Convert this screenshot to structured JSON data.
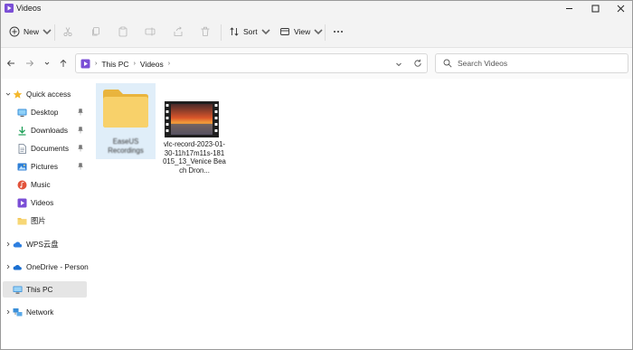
{
  "window": {
    "title": "Videos"
  },
  "toolbar": {
    "new_label": "New",
    "sort_label": "Sort",
    "view_label": "View"
  },
  "breadcrumbs": [
    "This PC",
    "Videos"
  ],
  "search": {
    "placeholder": "Search Videos"
  },
  "sidebar": {
    "items": [
      {
        "label": "Quick access",
        "icon": "star-icon"
      },
      {
        "label": "Desktop",
        "icon": "desktop-icon",
        "pinned": true
      },
      {
        "label": "Downloads",
        "icon": "download-icon",
        "pinned": true
      },
      {
        "label": "Documents",
        "icon": "document-icon",
        "pinned": true
      },
      {
        "label": "Pictures",
        "icon": "pictures-icon",
        "pinned": true
      },
      {
        "label": "Music",
        "icon": "music-icon"
      },
      {
        "label": "Videos",
        "icon": "videos-icon"
      },
      {
        "label": "图片",
        "icon": "folder-icon"
      },
      {
        "label": "WPS云盘",
        "icon": "cloud-icon"
      },
      {
        "label": "OneDrive - Personal",
        "icon": "onedrive-icon"
      },
      {
        "label": "This PC",
        "icon": "computer-icon",
        "selected": true
      },
      {
        "label": "Network",
        "icon": "network-icon"
      }
    ]
  },
  "files": [
    {
      "name": "EaseUS Recordings",
      "type": "folder",
      "selected": true
    },
    {
      "name": "vlc-record-2023-01-30-11h17m11s-181015_13_Venice Beach Dron...",
      "type": "video"
    }
  ],
  "colors": {
    "accent": "#7b4fd6",
    "folder": "#f3c95b",
    "selection": "#e0eef9"
  }
}
